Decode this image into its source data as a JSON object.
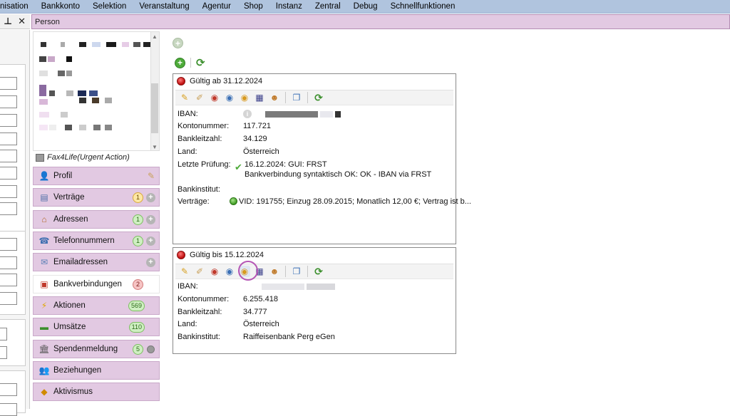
{
  "menu": [
    "nisation",
    "Bankkonto",
    "Selektion",
    "Veranstaltung",
    "Agentur",
    "Shop",
    "Instanz",
    "Zentral",
    "Debug",
    "Schnellfunktionen"
  ],
  "left_toolbar": {
    "pin": "⊥",
    "close": "✕"
  },
  "person_tab": "Person",
  "urgent_label": "Fax4Life(Urgent Action)",
  "nav": [
    {
      "label": "Profil",
      "icon": "person-icon",
      "extra": "pencil"
    },
    {
      "label": "Verträge",
      "icon": "contract-icon",
      "badge": "1",
      "badge_color": "yellow",
      "extra": "plus"
    },
    {
      "label": "Adressen",
      "icon": "house-icon",
      "badge": "1",
      "badge_color": "green",
      "extra": "plus"
    },
    {
      "label": "Telefonnummern",
      "icon": "phone-icon",
      "badge": "1",
      "badge_color": "green",
      "extra": "plus"
    },
    {
      "label": "Emailadressen",
      "icon": "mail-icon",
      "extra": "plus"
    },
    {
      "label": "Bankverbindungen",
      "icon": "bank-card-icon",
      "badge": "2",
      "badge_color": "red",
      "active": true
    },
    {
      "label": "Aktionen",
      "icon": "lightning-icon",
      "badge": "569",
      "badge_color": "green"
    },
    {
      "label": "Umsätze",
      "icon": "money-icon",
      "badge": "110",
      "badge_color": "green"
    },
    {
      "label": "Spendenmeldung",
      "icon": "institution-icon",
      "badge": "5",
      "badge_color": "green",
      "extra": "dot"
    },
    {
      "label": "Beziehungen",
      "icon": "people-icon"
    },
    {
      "label": "Aktivismus",
      "icon": "warning-sign-icon"
    }
  ],
  "cards": [
    {
      "title": "Gültig ab 31.12.2024",
      "rows": [
        {
          "k": "IBAN:",
          "v": ""
        },
        {
          "k": "Kontonummer:",
          "v": "117.721"
        },
        {
          "k": "Bankleitzahl:",
          "v": "34.129"
        },
        {
          "k": "Land:",
          "v": "Österreich"
        },
        {
          "k": "Letzte Prüfung:",
          "v": "16.12.2024: GUI: FRST",
          "v2": "Bankverbindung syntaktisch OK: OK - IBAN via FRST"
        },
        {
          "k": "Bankinstitut:",
          "v": ""
        },
        {
          "k": "Verträge:",
          "v": "VID: 191755; Einzug 28.09.2015; Monatlich 12,00 €; Vertrag ist b..."
        }
      ]
    },
    {
      "title": "Gültig bis 15.12.2024",
      "rows": [
        {
          "k": "IBAN:",
          "v": ""
        },
        {
          "k": "Kontonummer:",
          "v": "6.255.418"
        },
        {
          "k": "Bankleitzahl:",
          "v": "34.777"
        },
        {
          "k": "Land:",
          "v": "Österreich"
        },
        {
          "k": "Bankinstitut:",
          "v": "Raiffeisenbank Perg eGen"
        }
      ]
    }
  ],
  "colors": {
    "menubar": "#b0c4de",
    "nav_item": "#e2c9e2",
    "accent_green": "#4eab3a"
  }
}
